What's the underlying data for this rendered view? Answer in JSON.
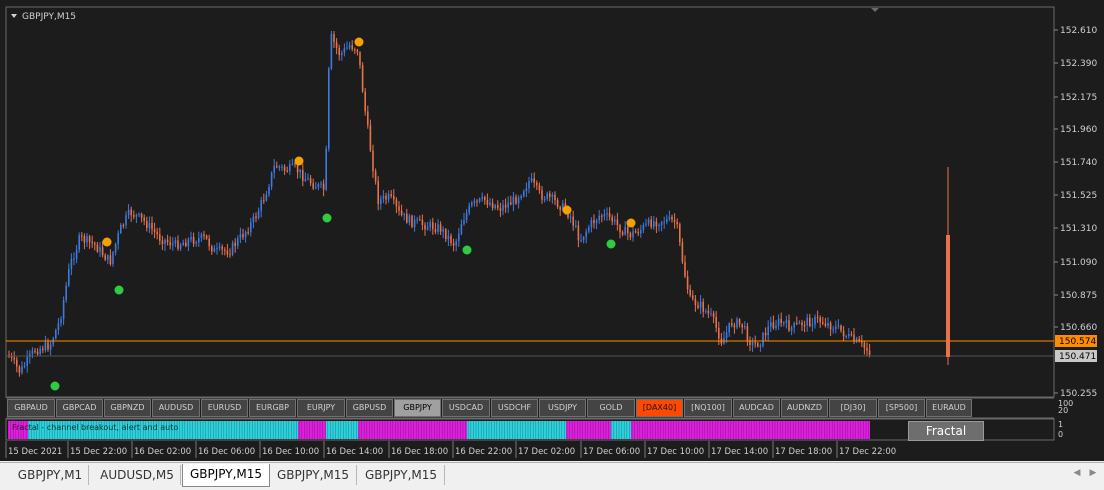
{
  "window": {
    "title": "GBPJPY,M15"
  },
  "colors": {
    "bull": "#3d7be0",
    "bear": "#e8734a",
    "up_fractal": "#f5a100",
    "down_fractal": "#2ecc40",
    "price_line": "#ff8c00",
    "cyan": "#2dd4e0",
    "magenta": "#e020e0"
  },
  "price_axis": {
    "ticks": [
      "152.610",
      "152.390",
      "152.175",
      "151.960",
      "151.740",
      "151.525",
      "151.310",
      "151.090",
      "150.875",
      "150.660",
      "150.255"
    ],
    "ask_label": "150.574",
    "bid_label": "150.471"
  },
  "sub_axis": {
    "top": "100",
    "mid": "20",
    "low": "1",
    "zero": "0"
  },
  "time_axis": [
    "15 Dec 2021",
    "15 Dec 22:00",
    "16 Dec 02:00",
    "16 Dec 06:00",
    "16 Dec 10:00",
    "16 Dec 14:00",
    "16 Dec 18:00",
    "16 Dec 22:00",
    "17 Dec 02:00",
    "17 Dec 06:00",
    "17 Dec 10:00",
    "17 Dec 14:00",
    "17 Dec 18:00",
    "17 Dec 22:00"
  ],
  "symbols": [
    {
      "label": "GBPAUD",
      "state": "normal"
    },
    {
      "label": "GBPCAD",
      "state": "normal"
    },
    {
      "label": "GBPNZD",
      "state": "normal"
    },
    {
      "label": "AUDUSD",
      "state": "normal"
    },
    {
      "label": "EURUSD",
      "state": "normal"
    },
    {
      "label": "EURGBP",
      "state": "normal"
    },
    {
      "label": "EURJPY",
      "state": "normal"
    },
    {
      "label": "GBPUSD",
      "state": "normal"
    },
    {
      "label": "GBPJPY",
      "state": "active"
    },
    {
      "label": "USDCAD",
      "state": "normal"
    },
    {
      "label": "USDCHF",
      "state": "normal"
    },
    {
      "label": "USDJPY",
      "state": "normal"
    },
    {
      "label": "GOLD",
      "state": "normal"
    },
    {
      "label": "[DAX40]",
      "state": "hot"
    },
    {
      "label": "[NQ100]",
      "state": "normal"
    },
    {
      "label": "AUDCAD",
      "state": "normal"
    },
    {
      "label": "AUDNZD",
      "state": "normal"
    },
    {
      "label": "[DJ30]",
      "state": "normal"
    },
    {
      "label": "[SP500]",
      "state": "normal"
    },
    {
      "label": "EURAUD",
      "state": "normal"
    }
  ],
  "indicator": {
    "label": "Fractal - channel breakout, alert and auto",
    "button": "Fractal"
  },
  "tabs": [
    {
      "label": "GBPJPY,M1",
      "active": false
    },
    {
      "label": "AUDUSD,M5",
      "active": false
    },
    {
      "label": "GBPJPY,M15",
      "active": true
    },
    {
      "label": "GBPJPY,M15",
      "active": false
    },
    {
      "label": "GBPJPY,M15",
      "active": false
    }
  ]
}
